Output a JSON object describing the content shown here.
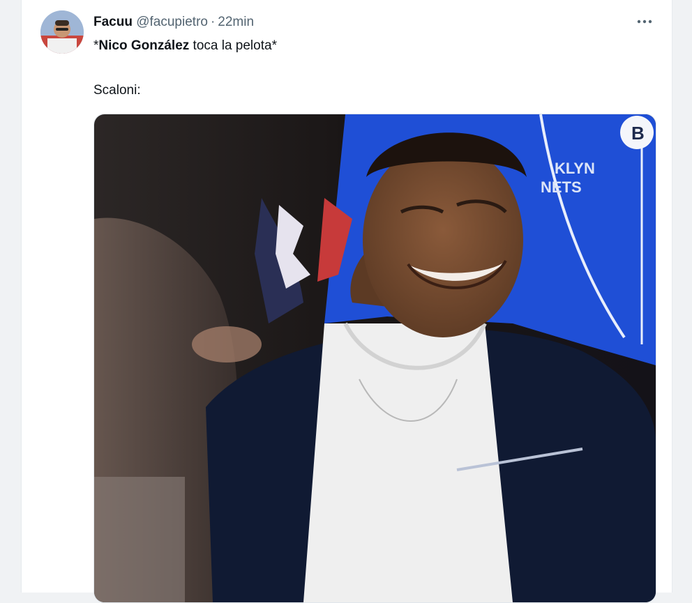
{
  "tweet": {
    "author": {
      "display_name": "Facuu",
      "handle": "@facupietro",
      "separator": "·",
      "timestamp": "22min"
    },
    "text": {
      "line1_prefix": "*",
      "line1_bold": "Nico González",
      "line1_rest": " toca la pelota*",
      "line2": "Scaloni:"
    },
    "more_icon": "more-dots-icon",
    "media": {
      "jersey_text_line1": "KLYN",
      "jersey_text_line2": "NETS"
    }
  },
  "colors": {
    "text_primary": "#0f1419",
    "text_secondary": "#536471",
    "jersey_blue": "#1f4fd6",
    "jacket_navy": "#101a33"
  }
}
